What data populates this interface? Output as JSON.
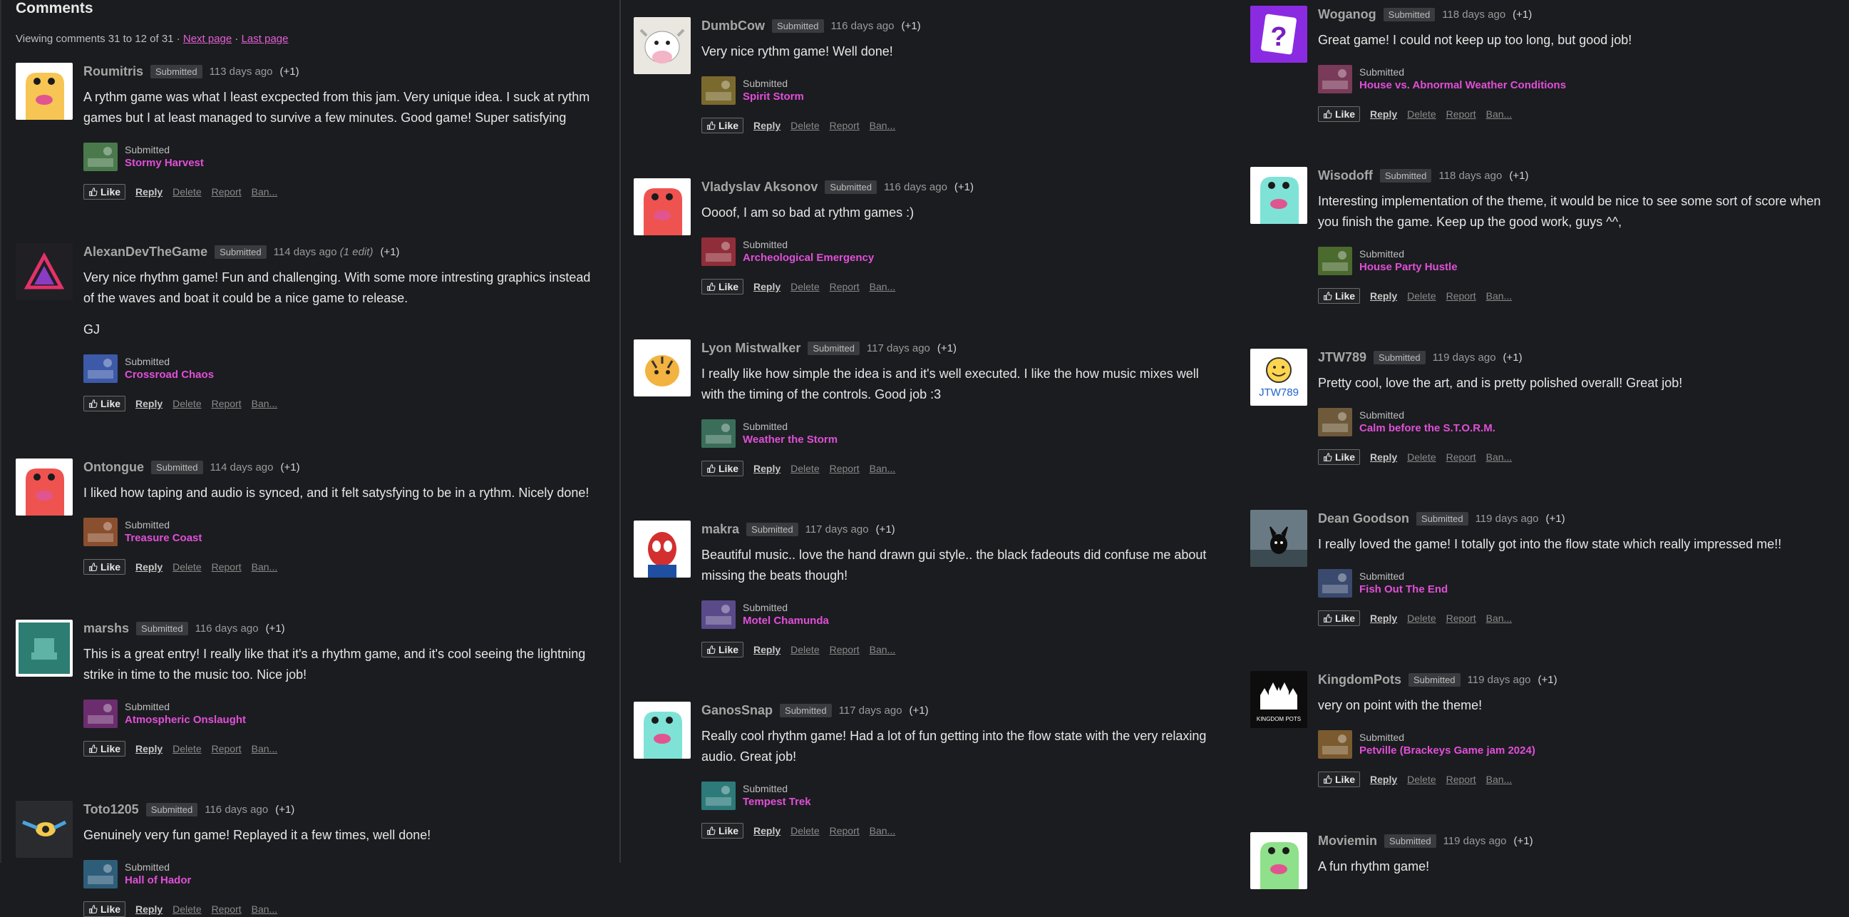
{
  "heading": "Comments",
  "paging": {
    "text": "Viewing comments 31 to 12 of 31 · ",
    "next": "Next page",
    "sep": " · ",
    "last": "Last page"
  },
  "labels": {
    "submitted_badge": "Submitted",
    "submitted_label": "Submitted",
    "like": "Like",
    "reply": "Reply",
    "delete": "Delete",
    "report": "Report",
    "ban": "Ban...",
    "plus_one": "(+1)"
  },
  "colors": {
    "background": "#1b1c1f",
    "game_link": "#e04fd8",
    "badge_bg": "#3a3b3e",
    "author": "#a6a6a6"
  },
  "comments": [
    {
      "author": "Roumitris",
      "time": "113 days ago",
      "avatar": "yellow-frog-avatar",
      "text": [
        "A rythm game was what I least excpected from this jam. Very unique idea. I suck at rythm games but I at least managed to survive a few minutes. Good game! Super satisfying"
      ],
      "game": "Stormy Harvest"
    },
    {
      "author": "AlexanDevTheGame",
      "time": "114 days ago",
      "edit": "(1 edit)",
      "avatar": "triangle-logo-avatar",
      "text": [
        "Very nice rhythm game! Fun and challenging. With some more intresting graphics instead of the waves and boat it could be a nice game to release.",
        "GJ"
      ],
      "game": "Crossroad Chaos"
    },
    {
      "author": "Ontongue",
      "time": "114 days ago",
      "avatar": "red-frog-avatar",
      "text": [
        "I liked how taping and audio is synced, and it felt satysfying to be in a rythm. Nicely done!"
      ],
      "game": "Treasure Coast"
    },
    {
      "author": "marshs",
      "time": "116 days ago",
      "avatar": "teal-chair-avatar",
      "text": [
        "This is a great entry! I really like that it's a rhythm game, and it's cool seeing the lightning strike in time to the music too. Nice job!"
      ],
      "game": "Atmospheric Onslaught"
    },
    {
      "author": "Toto1205",
      "time": "116 days ago",
      "avatar": "bird-avatar",
      "text": [
        "Genuinely very fun game! Replayed it a few times, well done!"
      ],
      "game": "Hall of Hador"
    },
    {
      "author": "DumbCow",
      "time": "116 days ago",
      "avatar": "cow-avatar",
      "text": [
        "Very nice rythm game! Well done!"
      ],
      "game": "Spirit Storm"
    },
    {
      "author": "Vladyslav Aksonov",
      "time": "116 days ago",
      "avatar": "red-frog-avatar",
      "text": [
        "Oooof, I am so bad at rythm games :)"
      ],
      "game": "Archeological Emergency"
    },
    {
      "author": "Lyon Mistwalker",
      "time": "117 days ago",
      "avatar": "tiger-avatar",
      "text": [
        "I really like how simple the idea is and it's well executed. I like the how music mixes well with the timing of the controls. Good job :3"
      ],
      "game": "Weather the Storm"
    },
    {
      "author": "makra",
      "time": "117 days ago",
      "avatar": "spiderman-avatar",
      "text": [
        "Beautiful music.. love the hand drawn gui style.. the black fadeouts did confuse me about missing the beats though!"
      ],
      "game": "Motel Chamunda"
    },
    {
      "author": "GanosSnap",
      "time": "117 days ago",
      "avatar": "cyan-frog-avatar",
      "text": [
        "Really cool rhythm game! Had a lot of fun getting into the flow state with the very relaxing audio. Great job!"
      ],
      "game": "Tempest Trek"
    },
    {
      "author": "Woganog",
      "time": "118 days ago",
      "avatar": "question-mark-avatar",
      "text": [
        "Great game! I could not keep up too long, but good job!"
      ],
      "game": "House vs. Abnormal Weather Conditions"
    },
    {
      "author": "Wisodoff",
      "time": "118 days ago",
      "avatar": "cyan-frog-avatar",
      "text": [
        "Interesting implementation of the theme, it would be nice to see some sort of score when you finish the game.  Keep up the good work, guys ^^,"
      ],
      "game": "House Party Hustle"
    },
    {
      "author": "JTW789",
      "time": "119 days ago",
      "avatar": "smiley-avatar",
      "avatar_text": "JTW789",
      "text": [
        "Pretty cool, love the art, and is pretty polished overall!  Great job!"
      ],
      "game": "Calm before the S.T.O.R.M."
    },
    {
      "author": "Dean Goodson",
      "time": "119 days ago",
      "avatar": "black-creature-avatar",
      "text": [
        "I really loved the game! I totally got into the flow state which really impressed me!!"
      ],
      "game": "Fish Out The End"
    },
    {
      "author": "KingdomPots",
      "time": "119 days ago",
      "avatar": "castle-avatar",
      "avatar_text": "KINGDOM POTS",
      "text": [
        "very on point with the theme!"
      ],
      "game": "Petville (Brackeys Game jam 2024)"
    },
    {
      "author": "Moviemin",
      "time": "119 days ago",
      "avatar": "green-frog-avatar",
      "text": [
        "A fun rhythm game!"
      ],
      "game": ""
    }
  ]
}
